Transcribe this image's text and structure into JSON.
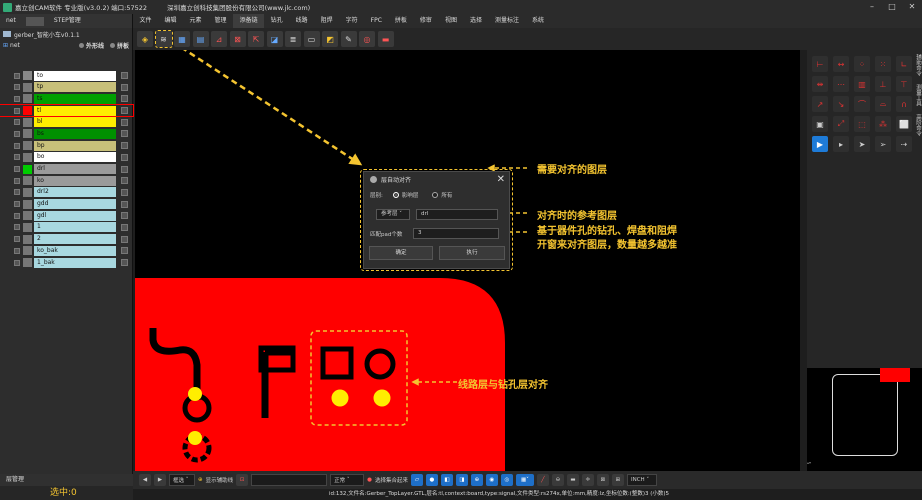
{
  "titlebar": {
    "title": "嘉立创CAM软件 专业版(v3.0.2) 端口:57522",
    "company": "深圳嘉立创科技集团股份有限公司(www.jlc.com)"
  },
  "left_panel": {
    "tabs": [
      "net",
      "STEP管理"
    ],
    "project": "gerber_智能小车v0.1.1",
    "net_label": "net",
    "options": [
      "外形线",
      "拼板"
    ],
    "layers": [
      {
        "name": "to",
        "color": "#ffffff",
        "sw": "#888888"
      },
      {
        "name": "tp",
        "color": "#c8c07a",
        "sw": "#777777"
      },
      {
        "name": "ts",
        "color": "#00a000",
        "sw": "#777777"
      },
      {
        "name": "tl",
        "color": "#ffee00",
        "sw": "#ff0000"
      },
      {
        "name": "bl",
        "color": "#ffee00",
        "sw": "#777777"
      },
      {
        "name": "bs",
        "color": "#009000",
        "sw": "#777777"
      },
      {
        "name": "bp",
        "color": "#c8c07a",
        "sw": "#777777"
      },
      {
        "name": "bo",
        "color": "#ffffff",
        "sw": "#777777"
      },
      {
        "name": "drl",
        "color": "#9a9a9a",
        "sw": "#00cc00"
      },
      {
        "name": "ko",
        "color": "#9a9a9a",
        "sw": "#777777"
      },
      {
        "name": "drl2",
        "color": "#a8d8e0",
        "sw": "#777777"
      },
      {
        "name": "gdd",
        "color": "#a8d8e0",
        "sw": "#777777"
      },
      {
        "name": "gdl",
        "color": "#a8d8e0",
        "sw": "#777777"
      },
      {
        "name": "1",
        "color": "#a8d8e0",
        "sw": "#777777"
      },
      {
        "name": "2",
        "color": "#a8d8e0",
        "sw": "#777777"
      },
      {
        "name": "ko_bak",
        "color": "#a8d8e0",
        "sw": "#777777"
      },
      {
        "name": "1_bak",
        "color": "#a8d8e0",
        "sw": "#777777"
      }
    ],
    "manager_tab": "层管理",
    "selected_label": "选中:0"
  },
  "menubar": {
    "items": [
      "文件",
      "编辑",
      "元素",
      "管理",
      "添备链",
      "钻孔",
      "线路",
      "阻焊",
      "字符",
      "FPC",
      "拼板",
      "修审",
      "视图",
      "选择",
      "测量标注",
      "系统"
    ],
    "active_index": 4
  },
  "dialog": {
    "title": "层自动对齐",
    "layer_label": "层别:",
    "radio_current": "影响层",
    "radio_all": "所有",
    "ref_label": "参考层",
    "ref_value": "drl",
    "pad_label": "匹配pad个数",
    "pad_value": "3",
    "ok_label": "确定",
    "run_label": "执行"
  },
  "callouts": {
    "c1": "需要对齐的图层",
    "c2": "对齐时的参考图层",
    "c3a": "基于器件孔的钻孔、焊盘和阻焊",
    "c3b": "开窗来对齐图层，数量越多越准",
    "c4": "线路层与钻孔层对齐"
  },
  "right_panel": {
    "tabs": [
      "辅助命令",
      "测量工具",
      "高阶命令"
    ]
  },
  "bottombar": {
    "mode": "框选",
    "show_btn": "显示辅助线",
    "status": "正常",
    "sel_btn": "选择集合起来",
    "unit": "INCH"
  },
  "status_text": "id:132,文件名:Gerber_TopLayer.GTL,层名:tl,context:board,type:signal,文件类型:rs274x,单位:mm,精度:lz,坐标位数:(整数)3 (小数)5",
  "colors": {
    "board": "#ff0000",
    "drill": "#ffee00",
    "accent": "#f4c430"
  }
}
